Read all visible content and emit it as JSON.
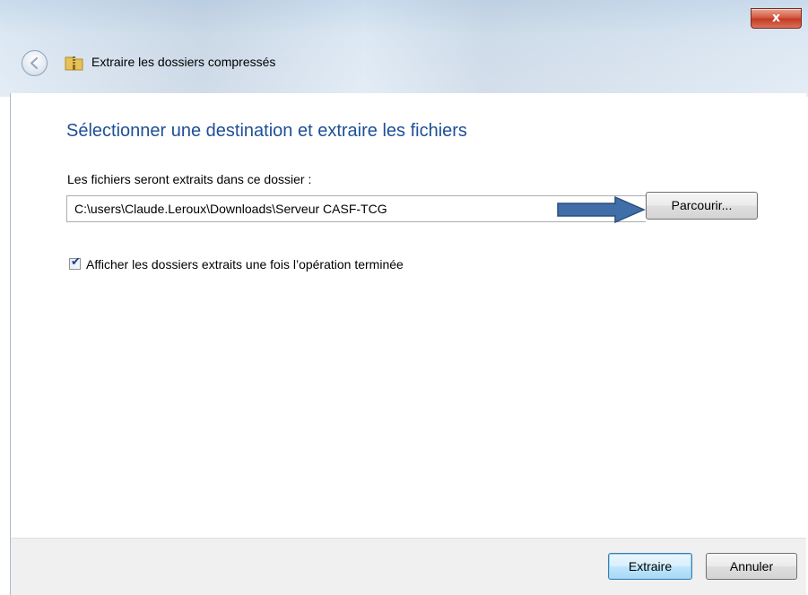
{
  "window": {
    "title": "Extraire les dossiers compressés",
    "close_label": "x"
  },
  "main": {
    "heading": "Sélectionner une destination et extraire les fichiers",
    "destination_label": "Les fichiers seront extraits dans ce dossier :",
    "destination_value": "C:\\users\\Claude.Leroux\\Downloads\\Serveur CASF-TCG",
    "browse_label": "Parcourir...",
    "show_folders_checkbox": {
      "label": "Afficher les dossiers extraits une fois l’opération terminée",
      "checked": true,
      "mark": "✔"
    }
  },
  "footer": {
    "extract_label": "Extraire",
    "cancel_label": "Annuler"
  },
  "icons": {
    "back": "back-arrow-icon",
    "folder": "compressed-folder-icon",
    "annotation_arrow": "arrow-right-icon"
  },
  "colors": {
    "heading": "#1e4f98",
    "annotation_arrow": "#3f6ea8",
    "close_button": "#c94a34"
  }
}
